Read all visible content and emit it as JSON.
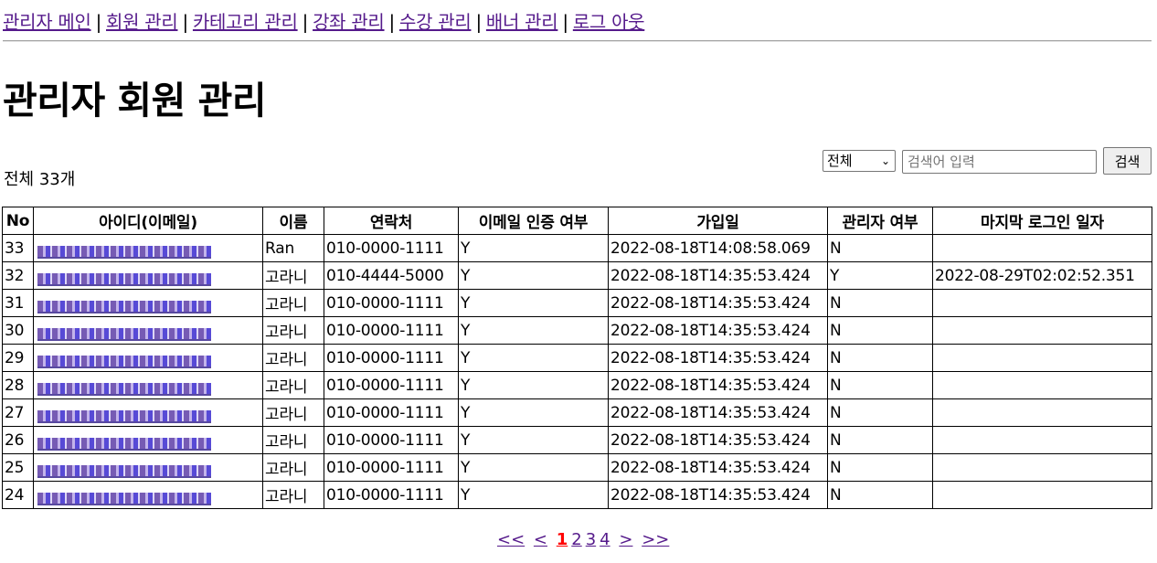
{
  "nav": {
    "items": [
      {
        "label": "관리자 메인"
      },
      {
        "label": "회원 관리"
      },
      {
        "label": "카테고리 관리"
      },
      {
        "label": "강좌 관리"
      },
      {
        "label": "수강 관리"
      },
      {
        "label": "배너 관리"
      },
      {
        "label": "로그 아웃"
      }
    ],
    "separator": "|"
  },
  "page_title": "관리자 회원 관리",
  "total_text": "전체 33개",
  "search": {
    "select_value": "전체",
    "placeholder": "검색어 입력",
    "button_label": "검색"
  },
  "table": {
    "headers": [
      "No",
      "아이디(이메일)",
      "이름",
      "연락처",
      "이메일 인증 여부",
      "가입일",
      "관리자 여부",
      "마지막 로그인 일자"
    ],
    "rows": [
      {
        "no": "33",
        "name": "Ran",
        "phone": "010-0000-1111",
        "email_auth": "Y",
        "joined": "2022-08-18T14:08:58.069",
        "admin": "N",
        "last_login": ""
      },
      {
        "no": "32",
        "name": "고라니",
        "phone": "010-4444-5000",
        "email_auth": "Y",
        "joined": "2022-08-18T14:35:53.424",
        "admin": "Y",
        "last_login": "2022-08-29T02:02:52.351"
      },
      {
        "no": "31",
        "name": "고라니",
        "phone": "010-0000-1111",
        "email_auth": "Y",
        "joined": "2022-08-18T14:35:53.424",
        "admin": "N",
        "last_login": ""
      },
      {
        "no": "30",
        "name": "고라니",
        "phone": "010-0000-1111",
        "email_auth": "Y",
        "joined": "2022-08-18T14:35:53.424",
        "admin": "N",
        "last_login": ""
      },
      {
        "no": "29",
        "name": "고라니",
        "phone": "010-0000-1111",
        "email_auth": "Y",
        "joined": "2022-08-18T14:35:53.424",
        "admin": "N",
        "last_login": ""
      },
      {
        "no": "28",
        "name": "고라니",
        "phone": "010-0000-1111",
        "email_auth": "Y",
        "joined": "2022-08-18T14:35:53.424",
        "admin": "N",
        "last_login": ""
      },
      {
        "no": "27",
        "name": "고라니",
        "phone": "010-0000-1111",
        "email_auth": "Y",
        "joined": "2022-08-18T14:35:53.424",
        "admin": "N",
        "last_login": ""
      },
      {
        "no": "26",
        "name": "고라니",
        "phone": "010-0000-1111",
        "email_auth": "Y",
        "joined": "2022-08-18T14:35:53.424",
        "admin": "N",
        "last_login": ""
      },
      {
        "no": "25",
        "name": "고라니",
        "phone": "010-0000-1111",
        "email_auth": "Y",
        "joined": "2022-08-18T14:35:53.424",
        "admin": "N",
        "last_login": ""
      },
      {
        "no": "24",
        "name": "고라니",
        "phone": "010-0000-1111",
        "email_auth": "Y",
        "joined": "2022-08-18T14:35:53.424",
        "admin": "N",
        "last_login": ""
      }
    ]
  },
  "pagination": {
    "first": "<<",
    "prev": "<",
    "pages": [
      "1",
      "2",
      "3",
      "4"
    ],
    "current": "1",
    "next": ">",
    "last": ">>"
  }
}
